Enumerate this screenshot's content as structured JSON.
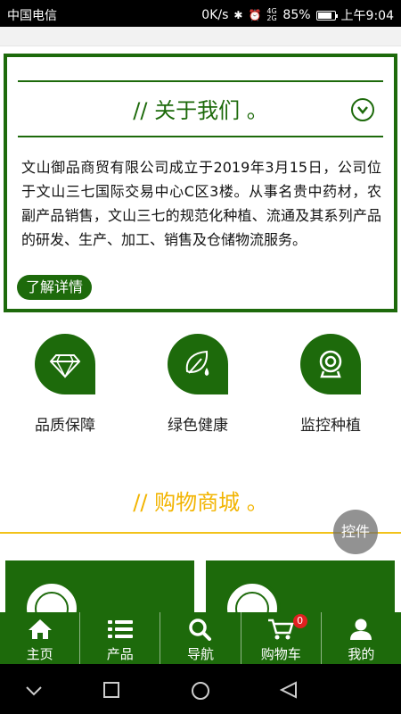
{
  "status_bar": {
    "carrier": "中国电信",
    "speed": "0K/s",
    "signal": "4G 2G",
    "battery": "85%",
    "battery_level": 0.85,
    "time": "上午9:04"
  },
  "about": {
    "title": "//  关于我们 。",
    "description": "文山御品商贸有限公司成立于2019年3月15日，公司位于文山三七国际交易中心C区3楼。从事名贵中药材，农副产品销售，文山三七的规范化种植、流通及其系列产品的研发、生产、加工、销售及仓储物流服务。",
    "more_label": "了解详情"
  },
  "features": [
    {
      "icon": "diamond-icon",
      "label": "品质保障"
    },
    {
      "icon": "leaf-drop-icon",
      "label": "绿色健康"
    },
    {
      "icon": "webcam-icon",
      "label": "监控种植"
    }
  ],
  "shop": {
    "title": "//  购物商城 。"
  },
  "floating_button": {
    "label": "控件"
  },
  "nav": {
    "items": [
      {
        "icon": "home-icon",
        "label": "主页"
      },
      {
        "icon": "list-icon",
        "label": "产品"
      },
      {
        "icon": "search-icon",
        "label": "导航"
      },
      {
        "icon": "cart-icon",
        "label": "购物车",
        "badge": "0"
      },
      {
        "icon": "user-icon",
        "label": "我的"
      }
    ]
  },
  "colors": {
    "brand_green": "#1d6a0b",
    "accent_yellow": "#f2b400",
    "badge_red": "#e02020"
  }
}
